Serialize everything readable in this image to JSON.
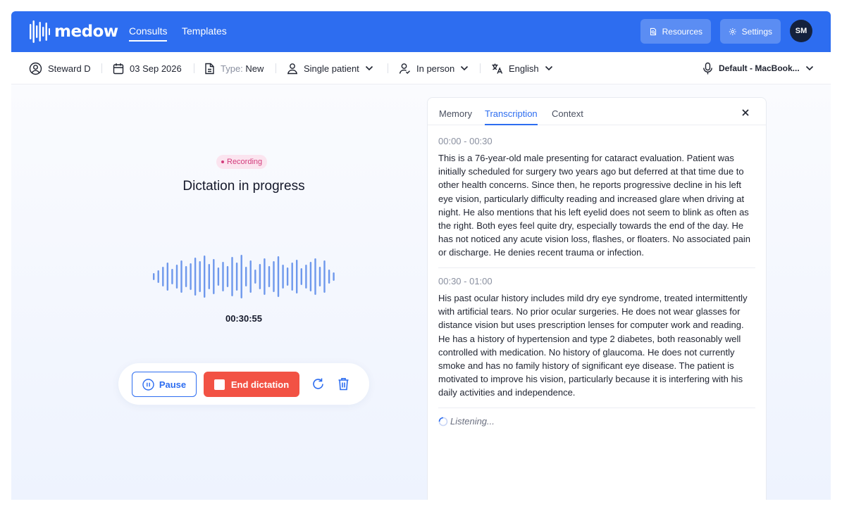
{
  "header": {
    "logo_text": "medow",
    "nav": [
      {
        "label": "Consults",
        "active": true
      },
      {
        "label": "Templates",
        "active": false
      }
    ],
    "resources_label": "Resources",
    "settings_label": "Settings",
    "avatar_initials": "SM",
    "brand_color": "#2d6df0"
  },
  "toolbar": {
    "patient": "Steward D",
    "date": "03 Sep 2026",
    "type_prefix": "Type:",
    "type_value": "New",
    "patient_mode": "Single patient",
    "location": "In person",
    "language": "English",
    "microphone": "Default - MacBook..."
  },
  "recorder": {
    "status_badge": "Recording",
    "title": "Dictation in progress",
    "timer": "00:30:55",
    "pause_label": "Pause",
    "end_label": "End dictation",
    "end_color": "#f25244"
  },
  "panel": {
    "tabs": [
      "Memory",
      "Transcription",
      "Context"
    ],
    "active_tab": "Transcription",
    "segments": [
      {
        "time": "00:00 - 00:30",
        "text": "This is a 76-year-old male presenting for cataract evaluation. Patient was initially scheduled for surgery two years ago but deferred at that time due to other health concerns. Since then, he reports progressive decline in his left eye vision, particularly difficulty reading and increased glare when driving at night. He also mentions that his left eyelid does not seem to blink as often as the right. Both eyes feel quite dry, especially towards the end of the day. He has not noticed any acute vision loss, flashes, or floaters. No associated pain or discharge. He denies recent trauma or infection."
      },
      {
        "time": "00:30 - 01:00",
        "text": "His past ocular history includes mild dry eye syndrome, treated intermittently with artificial tears. No prior ocular surgeries. He does not wear glasses for distance vision but uses prescription lenses for computer work and reading. He has a history of hypertension and type 2 diabetes, both reasonably well controlled with medication. No history of glaucoma. He does not currently smoke and has no family history of significant eye disease. The patient is motivated to improve his vision, particularly because it is interfering with his daily activities and independence."
      }
    ],
    "listening_label": "Listening..."
  }
}
